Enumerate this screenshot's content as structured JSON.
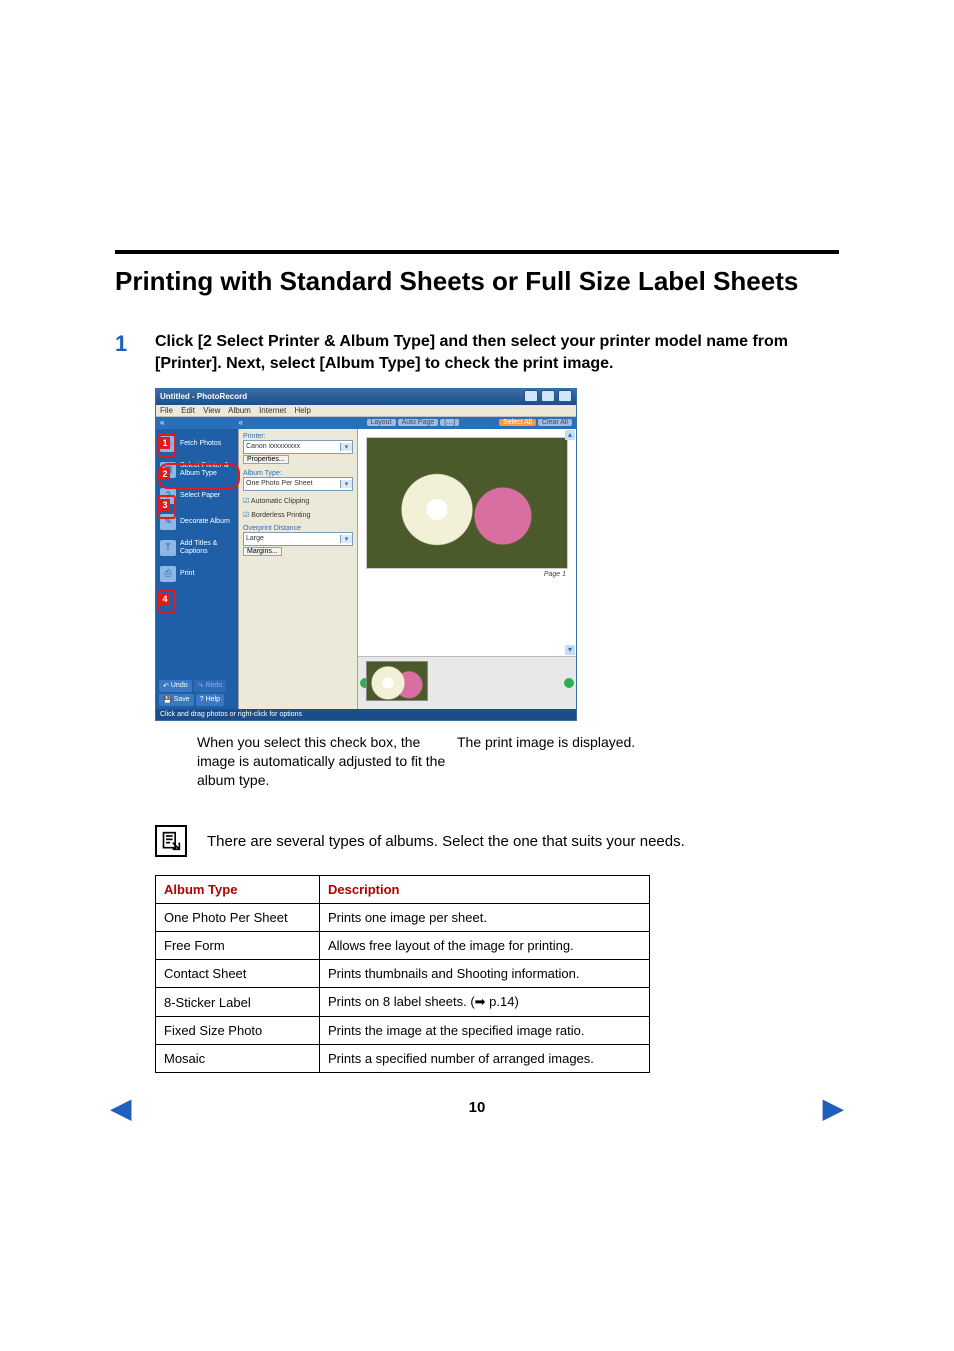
{
  "heading": "Printing with Standard Sheets or Full Size Label Sheets",
  "step": {
    "number": "1",
    "instruction": "Click [2 Select Printer & Album Type] and then select your printer model name from [Printer]. Next, select [Album Type] to check the print image."
  },
  "captions": {
    "left": "When you select this check box, the image is automatically adjusted to fit the album type.",
    "right": "The print image is displayed."
  },
  "note": "There are several types of albums. Select the one that suits your needs.",
  "table": {
    "headers": {
      "albumType": "Album Type",
      "description": "Description"
    },
    "rows": [
      {
        "type": "One Photo Per Sheet",
        "desc_html": "Prints one image per sheet."
      },
      {
        "type": "Free Form",
        "desc_html": "Allows free layout of the image for printing."
      },
      {
        "type": "Contact Sheet",
        "desc_html": "Prints thumbnails and Shooting information."
      },
      {
        "type": "8-Sticker Label",
        "desc_html": "Prints on 8 label sheets. (➡ p.14)"
      },
      {
        "type": "Fixed Size Photo",
        "desc_html": "Prints the image at the specified image ratio."
      },
      {
        "type": "Mosaic",
        "desc_html": "Prints a specified number of arranged images."
      }
    ]
  },
  "footer": {
    "pageNumber": "10"
  },
  "app": {
    "title": "Untitled - PhotoRecord",
    "menus": [
      "File",
      "Edit",
      "View",
      "Album",
      "Internet",
      "Help"
    ],
    "topstrip_buttons": [
      "Layout",
      "Auto Page",
      "[…]"
    ],
    "topstrip_right": {
      "selectAll": "Select All",
      "clearAll": "Clear All"
    },
    "sidebar": {
      "items": [
        {
          "label": "Fetch Photos"
        },
        {
          "label": "Select Printer & Album Type"
        },
        {
          "label": "Select Paper"
        },
        {
          "label": "Decorate Album"
        },
        {
          "label": "Add Titles & Captions"
        },
        {
          "label": "Print"
        }
      ],
      "bottom": {
        "undo": "Undo",
        "redo": "Redo",
        "save": "Save",
        "help": "Help"
      },
      "status": "Click and drag photos or right-click for options"
    },
    "midpanel": {
      "printerLabel": "Printer:",
      "printerValue": "Canon xxxxxxxxx",
      "propertiesBtn": "Properties...",
      "albumTypeLabel": "Album Type:",
      "albumTypeValue": "One Photo Per Sheet",
      "autoClip": "Automatic Clipping",
      "borderless": "Borderless Printing",
      "overprintLabel": "Overprint Distance",
      "overprintValue": "Large",
      "marginsBtn": "Margins..."
    },
    "preview": {
      "pageLabel": "Page 1"
    },
    "annotations": [
      "1",
      "2",
      "3",
      "4"
    ]
  }
}
